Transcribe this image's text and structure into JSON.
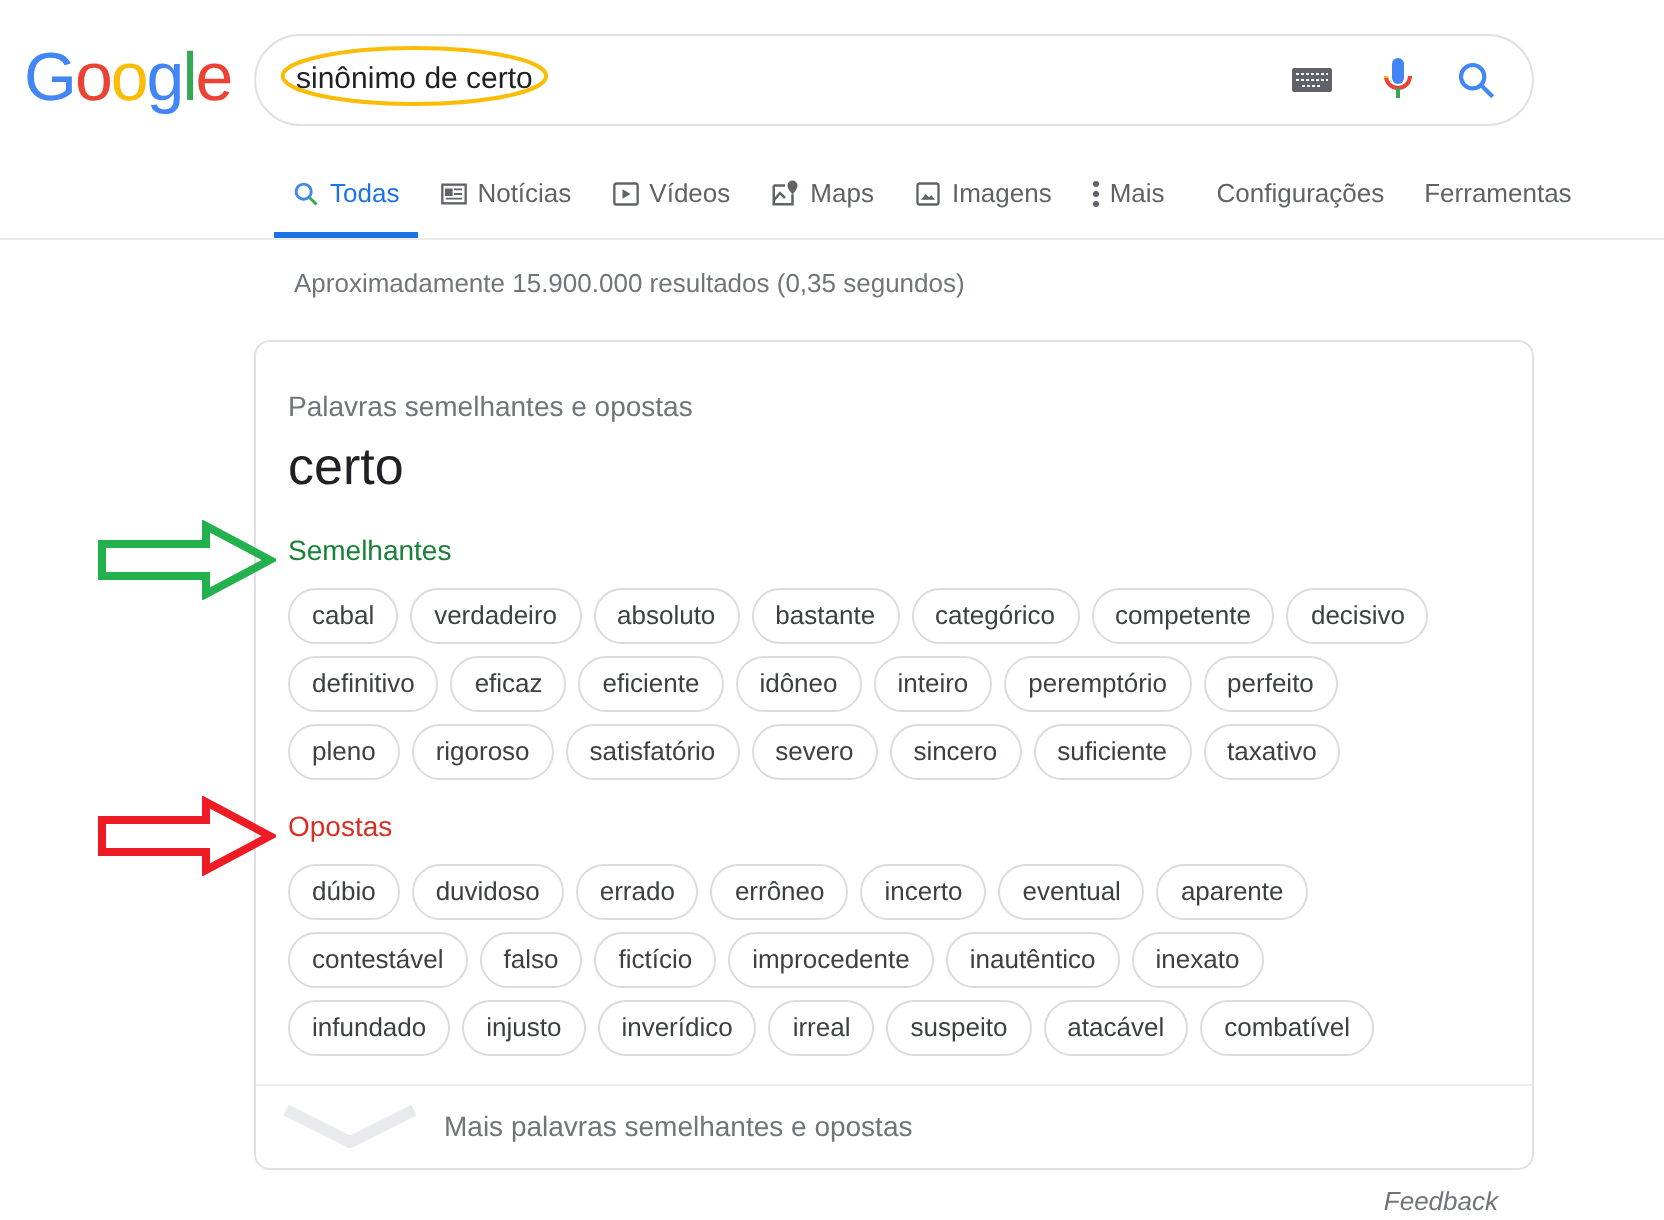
{
  "logo": "Google",
  "search": {
    "value": "sinônimo de certo",
    "highlighted": true
  },
  "tabs": [
    {
      "label": "Todas",
      "kind": "search",
      "selected": true
    },
    {
      "label": "Notícias",
      "kind": "news",
      "selected": false
    },
    {
      "label": "Vídeos",
      "kind": "videos",
      "selected": false
    },
    {
      "label": "Maps",
      "kind": "maps",
      "selected": false
    },
    {
      "label": "Imagens",
      "kind": "images",
      "selected": false
    },
    {
      "label": "Mais",
      "kind": "more",
      "selected": false
    },
    {
      "label": "Configurações",
      "selected": false
    },
    {
      "label": "Ferramentas",
      "selected": false
    }
  ],
  "result_stats": "Aproximadamente 15.900.000 resultados (0,35 segundos)",
  "card": {
    "subtitle": "Palavras semelhantes e opostas",
    "word": "certo",
    "sections": [
      {
        "title": "Semelhantes",
        "color": "#188038",
        "arrow": true,
        "rows": [
          [
            "cabal",
            "verdadeiro",
            "absoluto",
            "bastante",
            "categórico",
            "competente",
            "decisivo"
          ],
          [
            "definitivo",
            "eficaz",
            "eficiente",
            "idôneo",
            "inteiro",
            "peremptório",
            "perfeito"
          ],
          [
            "pleno",
            "rigoroso",
            "satisfatório",
            "severo",
            "sincero",
            "suficiente",
            "taxativo"
          ]
        ]
      },
      {
        "title": "Opostas",
        "color": "#d93025",
        "arrow": true,
        "rows": [
          [
            "dúbio",
            "duvidoso",
            "errado",
            "errôneo",
            "incerto",
            "eventual",
            "aparente"
          ],
          [
            "contestável",
            "falso",
            "fictício",
            "improcedente",
            "inautêntico",
            "inexato"
          ],
          [
            "infundado",
            "injusto",
            "inverídico",
            "irreal",
            "suspeito",
            "atacável",
            "combatível"
          ]
        ]
      }
    ],
    "more": "Mais palavras semelhantes e opostas"
  },
  "feedback": "Feedback"
}
